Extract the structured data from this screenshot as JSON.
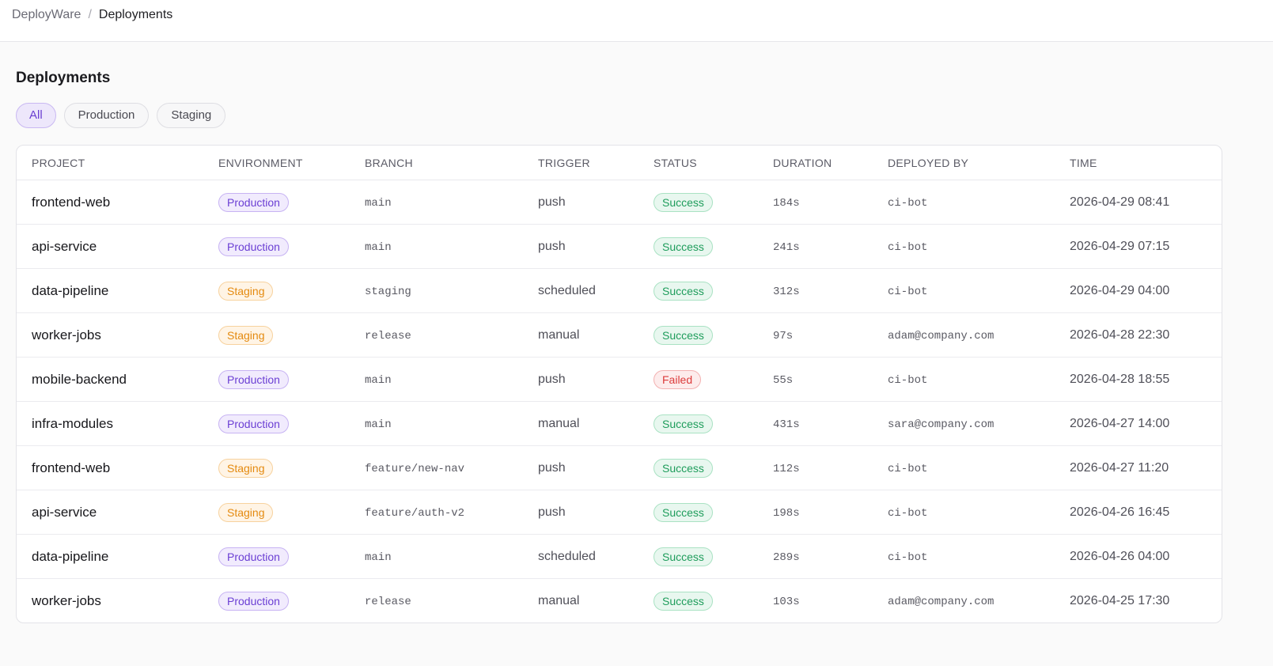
{
  "breadcrumb": {
    "root": "DeployWare",
    "separator": "/",
    "current": "Deployments"
  },
  "page": {
    "title": "Deployments"
  },
  "filters": [
    {
      "label": "All",
      "active": true
    },
    {
      "label": "Production",
      "active": false
    },
    {
      "label": "Staging",
      "active": false
    }
  ],
  "table": {
    "headers": [
      "PROJECT",
      "ENVIRONMENT",
      "BRANCH",
      "TRIGGER",
      "STATUS",
      "DURATION",
      "DEPLOYED BY",
      "TIME"
    ],
    "rows": [
      {
        "project": "frontend-web",
        "environment": "Production",
        "branch": "main",
        "trigger": "push",
        "status": "Success",
        "duration": "184s",
        "deployed_by": "ci-bot",
        "time": "2026-04-29 08:41"
      },
      {
        "project": "api-service",
        "environment": "Production",
        "branch": "main",
        "trigger": "push",
        "status": "Success",
        "duration": "241s",
        "deployed_by": "ci-bot",
        "time": "2026-04-29 07:15"
      },
      {
        "project": "data-pipeline",
        "environment": "Staging",
        "branch": "staging",
        "trigger": "scheduled",
        "status": "Success",
        "duration": "312s",
        "deployed_by": "ci-bot",
        "time": "2026-04-29 04:00"
      },
      {
        "project": "worker-jobs",
        "environment": "Staging",
        "branch": "release",
        "trigger": "manual",
        "status": "Success",
        "duration": "97s",
        "deployed_by": "adam@company.com",
        "time": "2026-04-28 22:30"
      },
      {
        "project": "mobile-backend",
        "environment": "Production",
        "branch": "main",
        "trigger": "push",
        "status": "Failed",
        "duration": "55s",
        "deployed_by": "ci-bot",
        "time": "2026-04-28 18:55"
      },
      {
        "project": "infra-modules",
        "environment": "Production",
        "branch": "main",
        "trigger": "manual",
        "status": "Success",
        "duration": "431s",
        "deployed_by": "sara@company.com",
        "time": "2026-04-27 14:00"
      },
      {
        "project": "frontend-web",
        "environment": "Staging",
        "branch": "feature/new-nav",
        "trigger": "push",
        "status": "Success",
        "duration": "112s",
        "deployed_by": "ci-bot",
        "time": "2026-04-27 11:20"
      },
      {
        "project": "api-service",
        "environment": "Staging",
        "branch": "feature/auth-v2",
        "trigger": "push",
        "status": "Success",
        "duration": "198s",
        "deployed_by": "ci-bot",
        "time": "2026-04-26 16:45"
      },
      {
        "project": "data-pipeline",
        "environment": "Production",
        "branch": "main",
        "trigger": "scheduled",
        "status": "Success",
        "duration": "289s",
        "deployed_by": "ci-bot",
        "time": "2026-04-26 04:00"
      },
      {
        "project": "worker-jobs",
        "environment": "Production",
        "branch": "release",
        "trigger": "manual",
        "status": "Success",
        "duration": "103s",
        "deployed_by": "adam@company.com",
        "time": "2026-04-25 17:30"
      }
    ]
  },
  "colors": {
    "accent": "#6a3fd1",
    "production": "#6b3fd4",
    "staging": "#e48a10",
    "success": "#1f9d5c",
    "failed": "#dc3b3b"
  }
}
